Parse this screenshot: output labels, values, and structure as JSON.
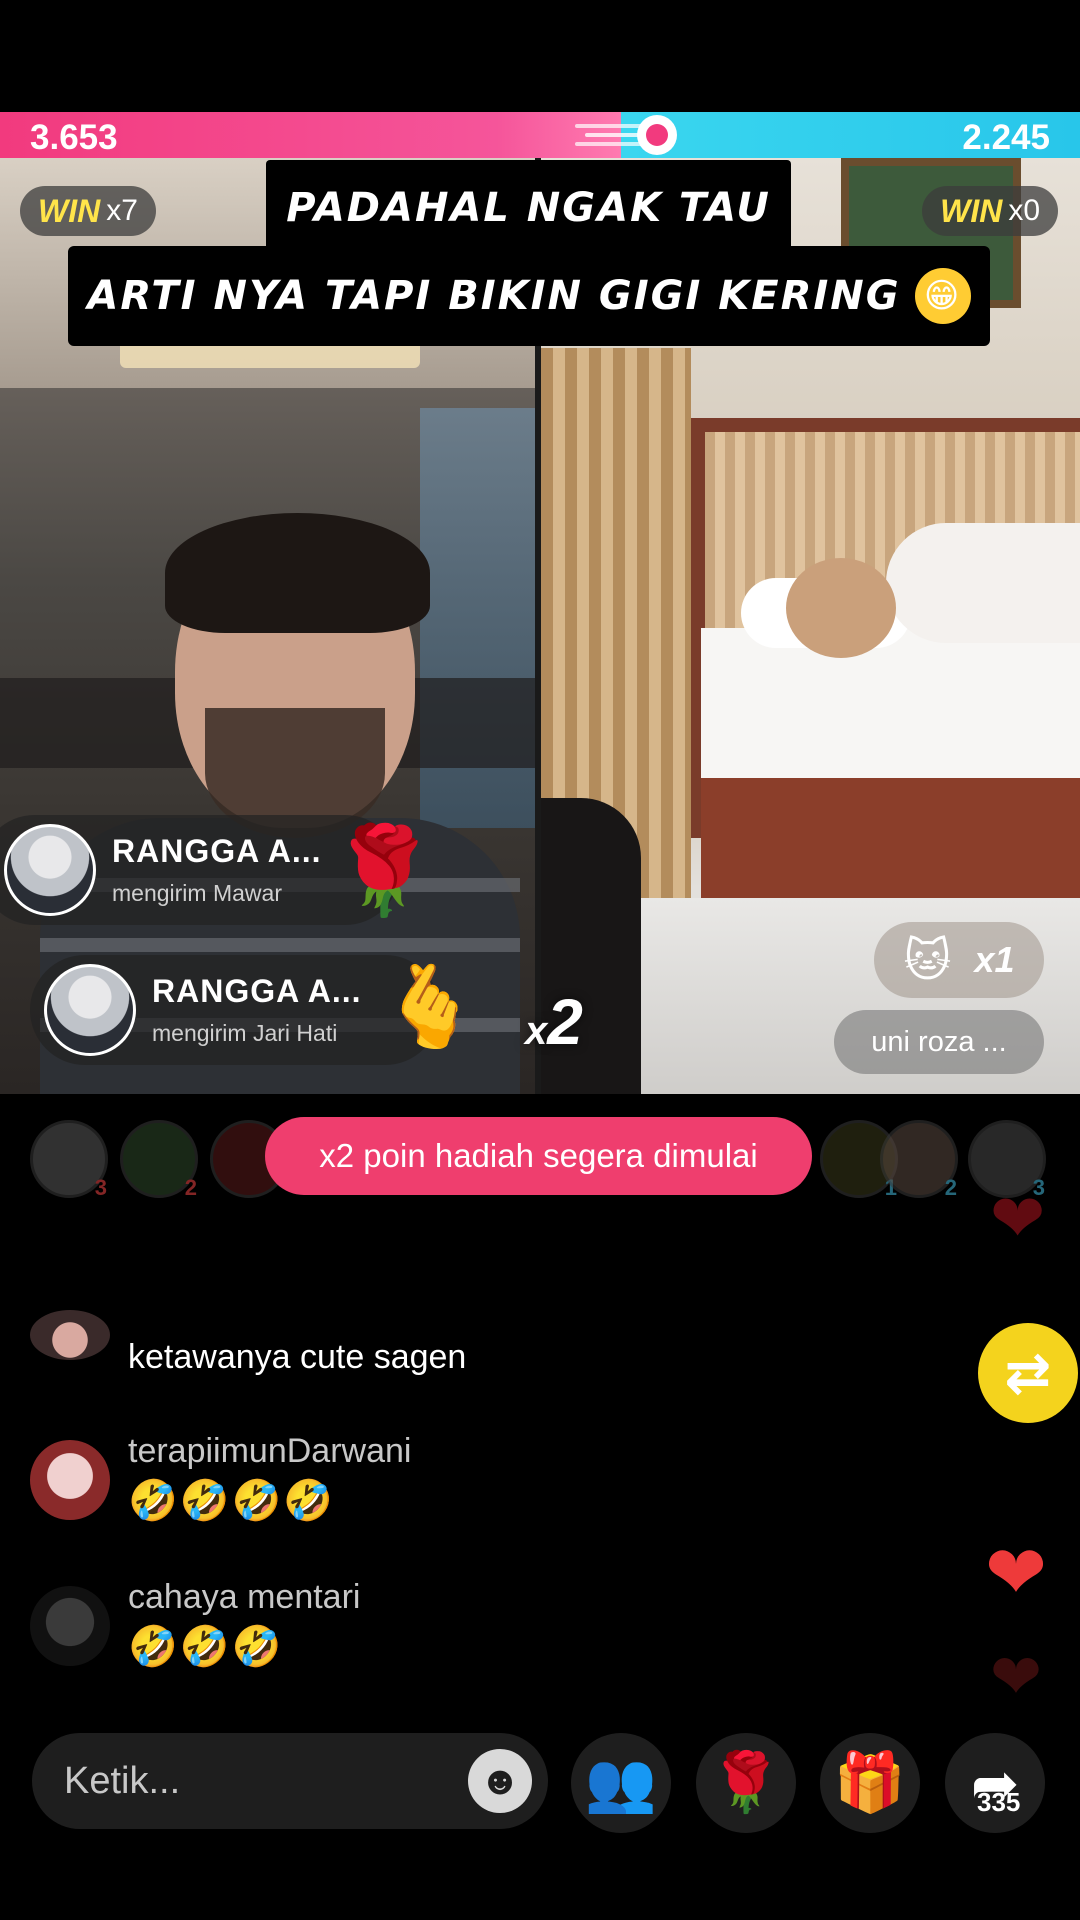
{
  "battle": {
    "left_score": "3.653",
    "right_score": "2.245",
    "left_progress": 0.575,
    "left_color": "#f23a7e",
    "right_color": "#28c6ea"
  },
  "wins": {
    "left_label": "WIN",
    "left_count": "x7",
    "right_label": "WIN",
    "right_count": "x0"
  },
  "caption": {
    "line1": "PADAHAL NGAK TAU",
    "line2": "ARTI NYA TAPI  BIKIN GIGI KERING",
    "emoji": "😁"
  },
  "gifts": [
    {
      "name": "RANGGA A...",
      "action": "mengirim Mawar",
      "icon": "rose-icon",
      "glyph": "🌹"
    },
    {
      "name": "RANGGA A...",
      "action": "mengirim Jari Hati",
      "icon": "finger-heart-icon",
      "glyph": "🫰"
    }
  ],
  "multiplier": {
    "prefix": "x",
    "value": "2"
  },
  "right_gift": {
    "glyph": "🐱",
    "count": "x1"
  },
  "right_host_name": "uni roza ...",
  "banner": "x2 poin hadiah segera dimulai",
  "viewer_ranks": [
    "3",
    "2",
    "",
    "1",
    "2",
    "3"
  ],
  "comments": [
    {
      "name": "",
      "text": "ketawanya cute sagen",
      "emoji": ""
    },
    {
      "name": "terapiimunDarwani",
      "text": "",
      "emoji": "🤣🤣🤣🤣"
    },
    {
      "name": "cahaya mentari",
      "text": "",
      "emoji": "🤣🤣🤣"
    }
  ],
  "input": {
    "placeholder": "Ketik..."
  },
  "actions": {
    "share_count": "335",
    "repost_glyph": "⇄",
    "invite_glyph": "👥",
    "rose_glyph": "🌹",
    "gift_glyph": "🎁",
    "share_glyph": "➦",
    "emoji_glyph": "☻"
  }
}
